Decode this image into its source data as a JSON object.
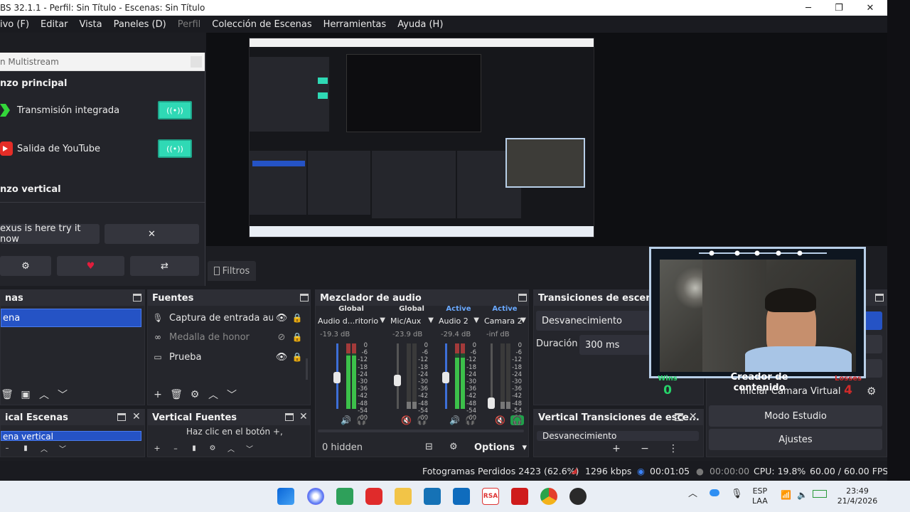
{
  "title_bar": {
    "title": "BS 32.1.1 - Perfil: Sin Título - Escenas: Sin Título",
    "minimize": "─",
    "maximize": "❐",
    "close": "✕"
  },
  "menu": [
    {
      "label": "ivo (F)",
      "enabled": true
    },
    {
      "label": "Editar",
      "enabled": true
    },
    {
      "label": "Vista",
      "enabled": true
    },
    {
      "label": "Paneles (D)",
      "enabled": true
    },
    {
      "label": "Perfil",
      "enabled": false
    },
    {
      "label": "Colección de Escenas",
      "enabled": true
    },
    {
      "label": "Herramientas",
      "enabled": true
    },
    {
      "label": "Ayuda (H)",
      "enabled": true
    }
  ],
  "multistream": {
    "title": "n Multistream",
    "section_main": "nzo principal",
    "outputs": [
      {
        "label": "Transmisión integrada",
        "icon": "green-chevron-icon"
      },
      {
        "label": "Salida de YouTube",
        "icon": "youtube-icon"
      }
    ],
    "toggle_symbol": "((•))",
    "section_vertical": "nzo vertical",
    "promo_text": "exus is here try it now",
    "dismiss_symbol": "✕",
    "settings_symbol": "⚙",
    "heart_symbol": "♥",
    "share_symbol": "⇄"
  },
  "filters_tab": "Filtros",
  "scenes": {
    "title": "nas",
    "selected": "ena",
    "toolbar": [
      "🗑",
      "▣",
      "︿",
      "﹀"
    ]
  },
  "sources": {
    "title": "Fuentes",
    "items": [
      {
        "name": "Captura de entrada aud",
        "icon": "mic-icon",
        "visible": true,
        "dim": false
      },
      {
        "name": "Medalla de honor",
        "icon": "link-icon",
        "visible": false,
        "dim": true
      },
      {
        "name": "Prueba",
        "icon": "monitor-icon",
        "visible": true,
        "dim": false
      }
    ],
    "toolbar": [
      "+",
      "🗑",
      "⚙",
      "︿",
      "﹀"
    ]
  },
  "mixer": {
    "title": "Mezclador de audio",
    "channels": [
      {
        "header": "Global",
        "name": "Audio d...ritorio",
        "db": "-19.3 dB",
        "muted": false,
        "active_level": 0.82
      },
      {
        "header": "Global",
        "name": "Mic/Aux",
        "db": "-23.9 dB",
        "muted": true,
        "active_level": 0.0
      },
      {
        "header": "Active",
        "name": "Audio 2",
        "db": "-29.4 dB",
        "muted": false,
        "active_level": 0.78
      },
      {
        "header": "Active",
        "name": "Camara 2",
        "db": "-inf dB",
        "muted": true,
        "active_level": 0.0
      }
    ],
    "ticks": [
      "0",
      "-6",
      "-12",
      "-18",
      "-24",
      "-30",
      "-36",
      "-42",
      "-48",
      "-54",
      "-60"
    ],
    "hidden_label": "0 hidden",
    "options_label": "Options"
  },
  "transitions": {
    "title": "Transiciones de escena",
    "transition": "Desvanecimiento",
    "duration_label": "Duración",
    "duration_value": "300 ms"
  },
  "controls": {
    "virtual_camera": "Iniciar Cámara Virtual",
    "studio_mode": "Modo Estudio",
    "settings": "Ajustes"
  },
  "vertical_scenes": {
    "title": "ical Escenas",
    "selected": "ena vertical"
  },
  "vertical_sources": {
    "title": "Vertical Fuentes",
    "hint": "Haz clic en el botón +,"
  },
  "vertical_transitions": {
    "title": "Vertical Transiciones de esce...",
    "value": "Desvanecimiento"
  },
  "webcam": {
    "caption": "Creador de contenido",
    "wins_label": "Wins",
    "wins_value": "0",
    "losses_label": "Losses",
    "losses_value": "4"
  },
  "status": {
    "dropped_frames": "Fotogramas Perdidos 2423 (62.6%)",
    "bitrate": "1296 kbps",
    "stream_time": "00:01:05",
    "record_time": "00:00:00",
    "cpu": "CPU: 19.8%",
    "fps": "60.00 / 60.00 FPS"
  },
  "taskbar": {
    "language": "ESP",
    "region": "LAA",
    "time": "23:49",
    "date": "21/4/2026",
    "tray_chevron": "︿"
  },
  "colors": {
    "accent_blue": "#2553c5",
    "toggle_teal": "#2fd9b5",
    "wins_green": "#26d46a",
    "losses_red": "#d02a2a"
  }
}
